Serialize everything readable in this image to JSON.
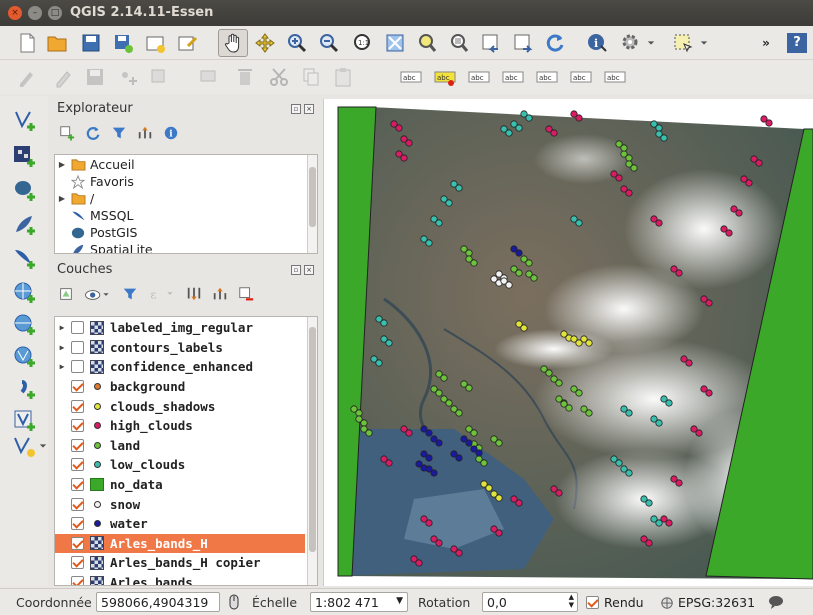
{
  "window": {
    "title": "QGIS 2.14.11-Essen",
    "close": "×",
    "minimize": "–",
    "maximize": "□"
  },
  "browser": {
    "title": "Explorateur",
    "items": [
      {
        "label": "Accueil",
        "icon": "folder-icon",
        "expandable": true
      },
      {
        "label": "Favoris",
        "icon": "star-icon",
        "expandable": false
      },
      {
        "label": "/",
        "icon": "folder-icon",
        "expandable": true
      },
      {
        "label": "MSSQL",
        "icon": "mssql-icon",
        "expandable": false
      },
      {
        "label": "PostGIS",
        "icon": "postgis-icon",
        "expandable": false
      },
      {
        "label": "SpatiaLite",
        "icon": "spatialite-icon",
        "expandable": false
      }
    ]
  },
  "layers": {
    "title": "Couches",
    "items": [
      {
        "label": "labeled_img_regular",
        "checked": false,
        "symbol": "raster",
        "expandable": true,
        "selected": false
      },
      {
        "label": "contours_labels",
        "checked": false,
        "symbol": "raster",
        "expandable": true,
        "selected": false
      },
      {
        "label": "confidence_enhanced",
        "checked": false,
        "symbol": "raster",
        "expandable": true,
        "selected": false
      },
      {
        "label": "background",
        "checked": true,
        "symbol": "point",
        "color": "#e07a2c",
        "expandable": false,
        "selected": false
      },
      {
        "label": "clouds_shadows",
        "checked": true,
        "symbol": "point",
        "color": "#e0e43a",
        "expandable": false,
        "selected": false
      },
      {
        "label": "high_clouds",
        "checked": true,
        "symbol": "point",
        "color": "#d91c63",
        "expandable": false,
        "selected": false
      },
      {
        "label": "land",
        "checked": true,
        "symbol": "point",
        "color": "#6cc23a",
        "expandable": false,
        "selected": false
      },
      {
        "label": "low_clouds",
        "checked": true,
        "symbol": "point",
        "color": "#39bfae",
        "expandable": false,
        "selected": false
      },
      {
        "label": "no_data",
        "checked": true,
        "symbol": "square",
        "color": "#3ca829",
        "expandable": false,
        "selected": false
      },
      {
        "label": "snow",
        "checked": true,
        "symbol": "point",
        "color": "#f2f2f2",
        "expandable": false,
        "selected": false
      },
      {
        "label": "water",
        "checked": true,
        "symbol": "point",
        "color": "#1a1a9e",
        "expandable": false,
        "selected": false
      },
      {
        "label": "Arles_bands_H",
        "checked": true,
        "symbol": "raster",
        "expandable": false,
        "selected": true
      },
      {
        "label": "Arles_bands_H copier",
        "checked": true,
        "symbol": "raster",
        "expandable": false,
        "selected": false
      },
      {
        "label": "Arles_bands",
        "checked": true,
        "symbol": "raster",
        "expandable": false,
        "selected": false
      }
    ]
  },
  "status": {
    "coord_label": "Coordonnée",
    "coord_value": "598066,4904319",
    "scale_label": "Échelle",
    "scale_value": "1:802 471",
    "rotation_label": "Rotation",
    "rotation_value": "0,0",
    "render_label": "Rendu",
    "render_checked": true,
    "crs": "EPSG:32631"
  },
  "toolbar": {
    "more": "»",
    "help": "?"
  },
  "colors": {
    "selection": "#f07746",
    "no_data": "#3ca829",
    "accent": "#e05a1c"
  }
}
